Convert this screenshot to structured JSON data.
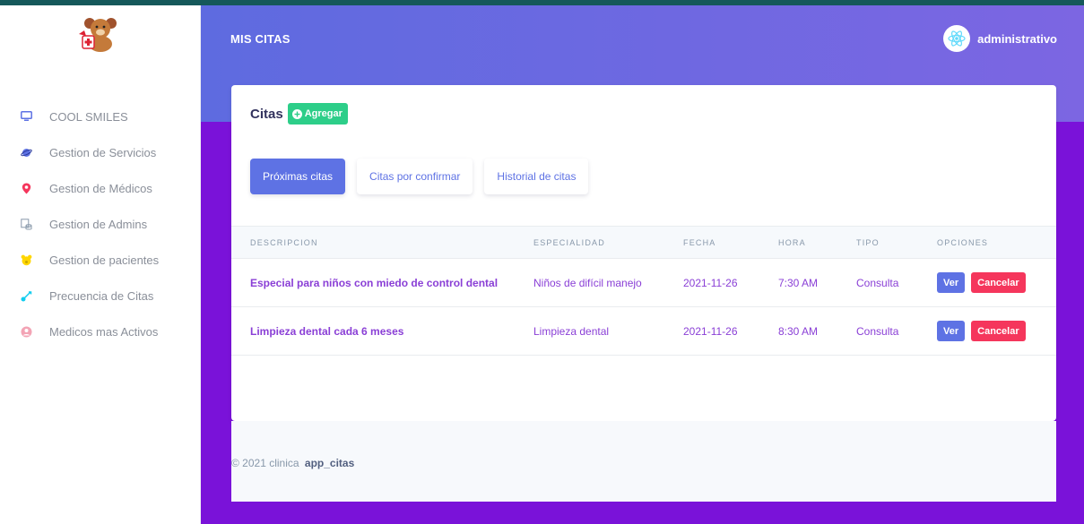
{
  "sidebar": {
    "items": [
      {
        "label": "COOL SMILES",
        "icon": "monitor-icon",
        "color": "#5e72e4"
      },
      {
        "label": "Gestion de Servicios",
        "icon": "planet-icon",
        "color": "#5e72e4"
      },
      {
        "label": "Gestion de Médicos",
        "icon": "map-pin-icon",
        "color": "#f5365c"
      },
      {
        "label": "Gestion de Admins",
        "icon": "database-icon",
        "color": "#8898aa"
      },
      {
        "label": "Gestion de pacientes",
        "icon": "bear-icon",
        "color": "#ffd600"
      },
      {
        "label": "Precuencia de Citas",
        "icon": "key-icon",
        "color": "#11cdef"
      },
      {
        "label": "Medicos mas Activos",
        "icon": "user-circle-icon",
        "color": "#f3a4b5"
      }
    ]
  },
  "header": {
    "title": "MIS CITAS",
    "user_name": "administrativo"
  },
  "card": {
    "title": "Citas",
    "add_label": "Agregar",
    "tabs": [
      {
        "label": "Próximas citas",
        "active": true
      },
      {
        "label": "Citas por confirmar",
        "active": false
      },
      {
        "label": "Historial de citas",
        "active": false
      }
    ],
    "table": {
      "columns": [
        "DESCRIPCION",
        "ESPECIALIDAD",
        "FECHA",
        "HORA",
        "TIPO",
        "OPCIONES"
      ],
      "rows": [
        {
          "descripcion": "Especial para niños con miedo de control dental",
          "especialidad": "Niños de difícil manejo",
          "fecha": "2021-11-26",
          "hora": "7:30 AM",
          "tipo": "Consulta"
        },
        {
          "descripcion": "Limpieza dental cada 6 meses",
          "especialidad": "Limpieza dental",
          "fecha": "2021-11-26",
          "hora": "8:30 AM",
          "tipo": "Consulta"
        }
      ],
      "view_label": "Ver",
      "cancel_label": "Cancelar"
    }
  },
  "footer": {
    "copyright": "© 2021 clinica",
    "brand": "app_citas"
  },
  "colors": {
    "primary": "#5e72e4",
    "success": "#2dce89",
    "danger": "#f5365c",
    "background": "#7a12d9"
  }
}
